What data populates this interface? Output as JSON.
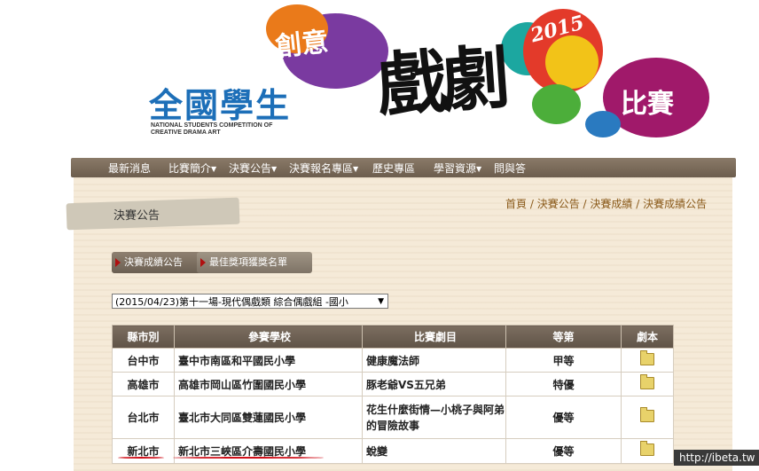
{
  "banner": {
    "logo_cn": "全國學生",
    "logo_en_line1": "NATIONAL STUDENTS COMPETITION OF",
    "logo_en_line2": "CREATIVE DRAMA ART",
    "creative": "創意",
    "drama": "戲劇",
    "year": "2015",
    "competition": "比賽"
  },
  "nav": {
    "items": [
      "最新消息",
      "比賽簡介",
      "決賽公告",
      "決賽報名專區",
      "歷史專區",
      "學習資源",
      "問與答"
    ]
  },
  "page_title": "決賽公告",
  "breadcrumb": [
    "首頁",
    "決賽公告",
    "決賽成績",
    "決賽成績公告"
  ],
  "tabs": [
    "決賽成績公告",
    "最佳獎項獲獎名單"
  ],
  "select": {
    "value": "(2015/04/23)第十一場-現代偶戲類 綜合偶戲組 -國小"
  },
  "table": {
    "headers": [
      "縣市別",
      "參賽學校",
      "比賽劇目",
      "等第",
      "劇本"
    ],
    "rows": [
      {
        "county": "台中市",
        "school": "臺中市南區和平國民小學",
        "play": "健康魔法師",
        "grade": "甲等"
      },
      {
        "county": "高雄市",
        "school": "高雄市岡山區竹圍國民小學",
        "play": "豚老爺VS五兄弟",
        "grade": "特優"
      },
      {
        "county": "台北市",
        "school": "臺北市大同區雙蓮國民小學",
        "play": "花生什麼街情—小桃子與阿弟的冒險故事",
        "grade": "優等"
      },
      {
        "county": "新北市",
        "school": "新北市三峽區介壽國民小學",
        "play": "蛻變",
        "grade": "優等"
      }
    ]
  },
  "watermark": "http://ibeta.tw",
  "colors": {
    "nav_bg": "#6c5d4d",
    "header_bg": "#5f5347",
    "content_bg": "#f5ead8",
    "highlight": "#d0101a"
  }
}
